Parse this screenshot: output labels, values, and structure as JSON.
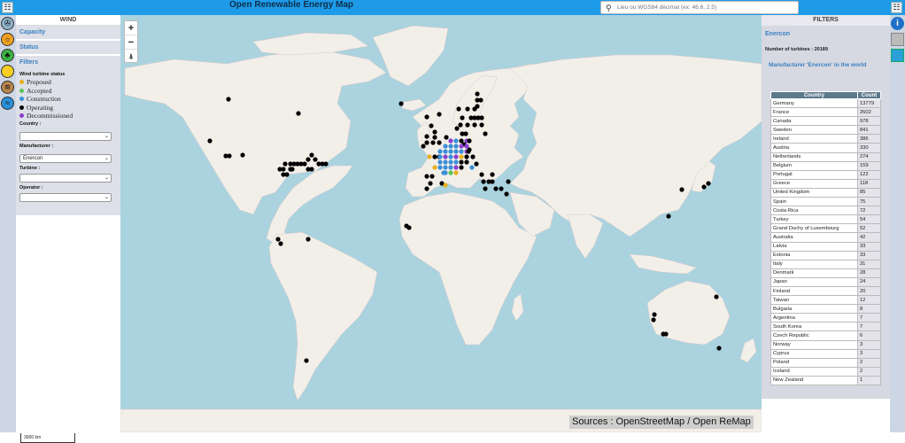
{
  "header": {
    "title": "Open Renewable Energy Map",
    "search_placeholder": "Lieu ou WGS84 décimal (ex: 46.6, 2.5)"
  },
  "left_panel": {
    "title": "WIND",
    "sections": [
      "Capacity",
      "Status",
      "Filters"
    ],
    "status_label": "Wind turbine status",
    "legend": [
      {
        "label": "Proposed",
        "color": "#e8b020"
      },
      {
        "label": "Accepted",
        "color": "#5cc25c"
      },
      {
        "label": "Construction",
        "color": "#3a8fd8"
      },
      {
        "label": "Operating",
        "color": "#000000"
      },
      {
        "label": "Decommissioned",
        "color": "#8a3fd0"
      }
    ],
    "country_label": "Country :",
    "country_value": "",
    "manufacturer_label": "Manufacturer :",
    "manufacturer_value": "Enercon",
    "turbine_label": "Turbine :",
    "turbine_value": "",
    "operator_label": "Operator :",
    "operator_value": ""
  },
  "map": {
    "zoom_in": "+",
    "zoom_out": "−",
    "locate": "⍋",
    "sources": "Sources : OpenStreetMap / Open ReMap",
    "scale": "3000 km"
  },
  "right_panel": {
    "title": "FILTERS",
    "manufacturer": "Enercon",
    "turbines_label": "Number of turbines : 20189",
    "world_title": "Manufacturer 'Enercon' in the world",
    "table_headers": [
      "Country",
      "Count"
    ],
    "rows": [
      [
        "Germany",
        "13779"
      ],
      [
        "France",
        "2602"
      ],
      [
        "Canada",
        "978"
      ],
      [
        "Sweden",
        "841"
      ],
      [
        "Ireland",
        "386"
      ],
      [
        "Austria",
        "330"
      ],
      [
        "Netherlands",
        "274"
      ],
      [
        "Belgium",
        "159"
      ],
      [
        "Portugal",
        "122"
      ],
      [
        "Greece",
        "118"
      ],
      [
        "United Kingdom",
        "85"
      ],
      [
        "Spain",
        "75"
      ],
      [
        "Costa Rica",
        "72"
      ],
      [
        "Turkey",
        "54"
      ],
      [
        "Grand Duchy of Luxembourg",
        "52"
      ],
      [
        "Australia",
        "42"
      ],
      [
        "Latvia",
        "33"
      ],
      [
        "Estonia",
        "33"
      ],
      [
        "Italy",
        "31"
      ],
      [
        "Denmark",
        "28"
      ],
      [
        "Japan",
        "24"
      ],
      [
        "Finland",
        "20"
      ],
      [
        "Taiwan",
        "12"
      ],
      [
        "Bulgaria",
        "8"
      ],
      [
        "Argentina",
        "7"
      ],
      [
        "South Korea",
        "7"
      ],
      [
        "Czech Republic",
        "6"
      ],
      [
        "Norway",
        "3"
      ],
      [
        "Cyprus",
        "3"
      ],
      [
        "Poland",
        "2"
      ],
      [
        "Iceland",
        "2"
      ],
      [
        "New Zealand",
        "1"
      ]
    ]
  },
  "colors": {
    "topbar": "#1e9be8",
    "water": "#aad3df",
    "land": "#f2efe9"
  }
}
